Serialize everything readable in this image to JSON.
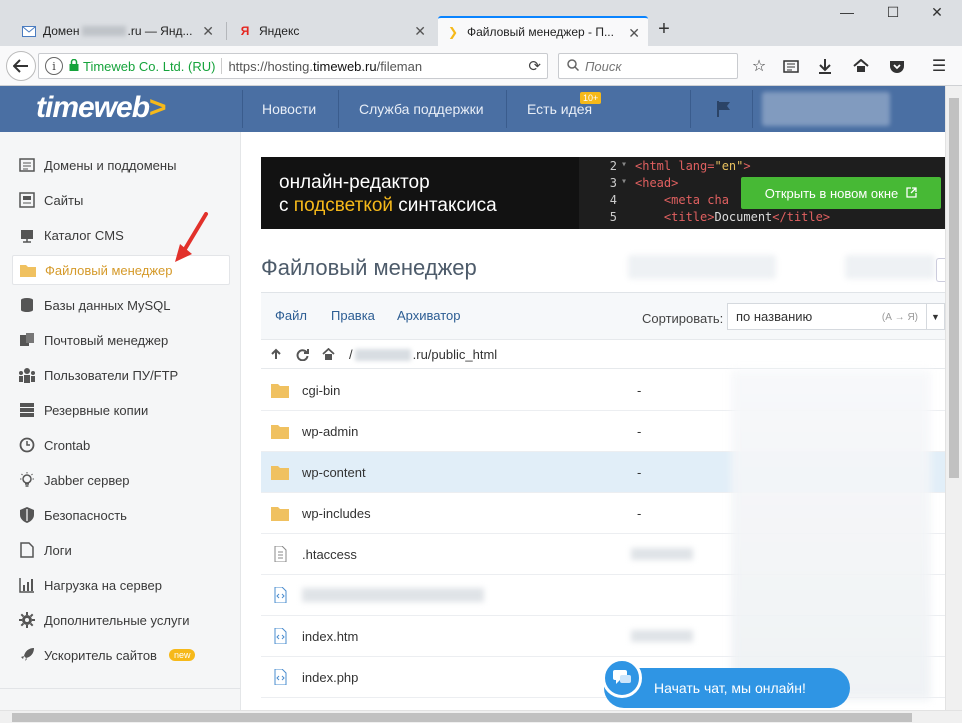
{
  "browser": {
    "tabs": [
      {
        "label_prefix": "Домен ",
        "label_suffix": ".ru — Янд...",
        "icon": "mail-icon"
      },
      {
        "label": "Яндекс",
        "icon": "yandex-icon"
      },
      {
        "label": "Файловый менеджер - П...",
        "icon": "timeweb-icon"
      }
    ],
    "url": {
      "org": "Timeweb Co. Ltd. (RU)",
      "prefix": "https://hosting.",
      "host": "timeweb.ru",
      "path": "/fileman"
    },
    "search_placeholder": "Поиск"
  },
  "site": {
    "logo": "timeweb",
    "logo_chevron": ">",
    "nav": [
      "Новости",
      "Служба поддержки",
      "Есть идея"
    ],
    "idea_badge": "10+"
  },
  "sidebar": {
    "items": [
      {
        "label": "Домены и поддомены",
        "icon": "domains-icon"
      },
      {
        "label": "Сайты",
        "icon": "sites-icon"
      },
      {
        "label": "Каталог CMS",
        "icon": "cms-icon"
      },
      {
        "label": "Файловый менеджер",
        "icon": "folder-icon",
        "active": true
      },
      {
        "label": "Базы данных MySQL",
        "icon": "database-icon"
      },
      {
        "label": "Почтовый менеджер",
        "icon": "mail-icon"
      },
      {
        "label": "Пользователи ПУ/FTP",
        "icon": "users-icon"
      },
      {
        "label": "Резервные копии",
        "icon": "backup-icon"
      },
      {
        "label": "Crontab",
        "icon": "clock-icon"
      },
      {
        "label": "Jabber сервер",
        "icon": "bulb-icon"
      },
      {
        "label": "Безопасность",
        "icon": "shield-icon"
      },
      {
        "label": "Логи",
        "icon": "logs-icon"
      },
      {
        "label": "Нагрузка на сервер",
        "icon": "chart-icon"
      },
      {
        "label": "Дополнительные услуги",
        "icon": "gear-icon"
      },
      {
        "label": "Ускоритель сайтов",
        "icon": "rocket-icon",
        "badge": "new"
      }
    ]
  },
  "banner": {
    "line1": "онлайн-редактор",
    "line2_pre": "с ",
    "line2_hl": "подсветкой",
    "line2_post": " синтаксиса",
    "code": [
      {
        "n": "2",
        "arrow": "▾",
        "open": "<html lang=",
        "str": "\"en\"",
        "close": ">"
      },
      {
        "n": "3",
        "arrow": "▾",
        "open": "<head>",
        "str": "",
        "close": ""
      },
      {
        "n": "4",
        "arrow": "",
        "open": "    <meta cha",
        "str": "",
        "close": ""
      },
      {
        "n": "5",
        "arrow": "",
        "open": "    <title>",
        "str": "Document",
        "close": "</title>"
      }
    ],
    "open_button": "Открыть в новом окне"
  },
  "filemanager": {
    "title": "Файловый менеджер",
    "menu": [
      "Файл",
      "Правка",
      "Архиватор"
    ],
    "sort_label": "Сортировать:",
    "sort_value": "по названию",
    "sort_hint": "(А → Я)",
    "path_prefix": "/",
    "path_suffix": ".ru/public_html",
    "files": [
      {
        "name": "cgi-bin",
        "type": "folder",
        "size": "-"
      },
      {
        "name": "wp-admin",
        "type": "folder",
        "size": "-"
      },
      {
        "name": "wp-content",
        "type": "folder",
        "size": "-",
        "selected": true
      },
      {
        "name": "wp-includes",
        "type": "folder",
        "size": "-"
      },
      {
        "name": ".htaccess",
        "type": "file",
        "size": ""
      },
      {
        "name": "",
        "type": "html",
        "size": ""
      },
      {
        "name": "index.htm",
        "type": "html",
        "size": ""
      },
      {
        "name": "index.php",
        "type": "html",
        "size": ""
      }
    ]
  },
  "chat": {
    "label": "Начать чат, мы онлайн!"
  },
  "colors": {
    "brand_blue": "#4a6fa3",
    "accent_yellow": "#f6b91a",
    "green_button": "#47b935",
    "chat_blue": "#2f95e4"
  }
}
